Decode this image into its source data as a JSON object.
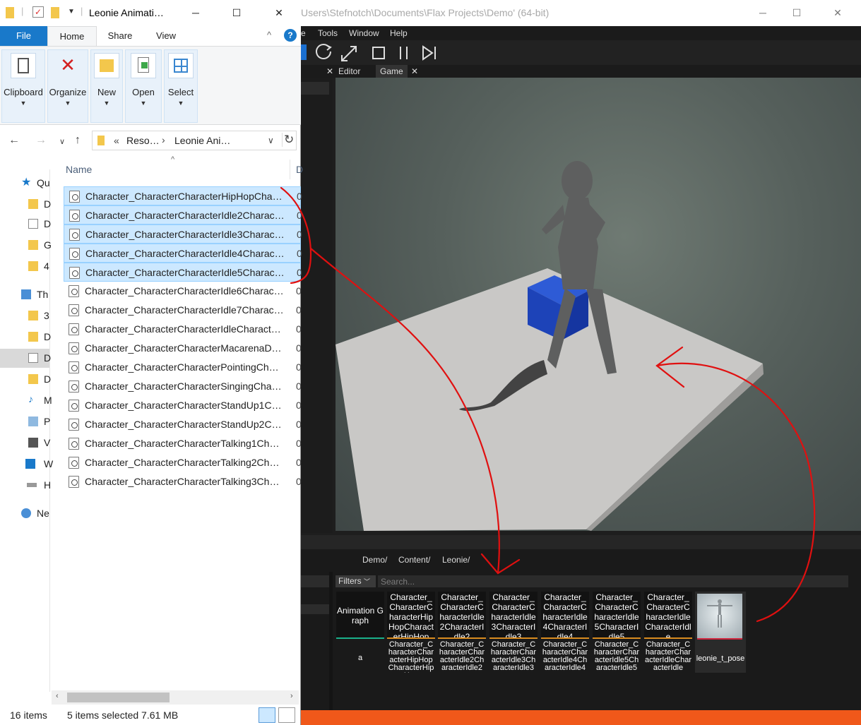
{
  "flax": {
    "title": "Users\\Stefnotch\\Documents\\Flax Projects\\Demo' (64-bit)",
    "menu": [
      "e",
      "Tools",
      "Window",
      "Help"
    ],
    "tabs": [
      {
        "label": "Editor"
      },
      {
        "label": "Game"
      }
    ],
    "breadcrumb": [
      "Demo/",
      "Content/",
      "Leonie/"
    ],
    "filters_label": "Filters",
    "search_placeholder": "Search...",
    "assets": [
      {
        "thumb": "Animation Graph",
        "name": "a"
      },
      {
        "thumb": "Character_CharacterCharacterHipHopCharacterHipHop",
        "name": "Character_CharacterCharacterHipHopCharacterHipHop"
      },
      {
        "thumb": "Character_CharacterCharacterIdle2CharacterIdle2",
        "name": "Character_CharacterCharacterIdle2CharacterIdle2"
      },
      {
        "thumb": "Character_CharacterCharacterIdle3CharacterIdle3",
        "name": "Character_CharacterCharacterIdle3CharacterIdle3"
      },
      {
        "thumb": "Character_CharacterCharacterIdle4CharacterIdle4",
        "name": "Character_CharacterCharacterIdle4CharacterIdle4"
      },
      {
        "thumb": "Character_CharacterCharacterIdle5CharacterIdle5",
        "name": "Character_CharacterCharacterIdle5CharacterIdle5"
      },
      {
        "thumb": "Character_CharacterCharacterIdleCharacterIdle",
        "name": "Character_CharacterCharacterIdleCharacterIdle"
      },
      {
        "thumb": "",
        "name": "leonie_t_pose"
      }
    ],
    "colors": {
      "accent_status": "#f0581a",
      "asset_underline": "#d88b1f"
    }
  },
  "explorer": {
    "title": "Leonie Animati…",
    "ribbon_tabs": [
      "File",
      "Home",
      "Share",
      "View"
    ],
    "ribbon_groups": [
      "Clipboard",
      "Organize",
      "New",
      "Open",
      "Select"
    ],
    "address": {
      "prefix": "«",
      "parts": [
        "Reso…",
        "Leonie Ani…"
      ]
    },
    "column_name": "Name",
    "column_next": "D",
    "sidebar": [
      "Qu",
      "D",
      "D",
      "G",
      "4",
      "Th",
      "3",
      "D",
      "D",
      "D",
      "M",
      "P",
      "V",
      "W",
      "H",
      "Ne"
    ],
    "files": [
      {
        "name": "Character_CharacterCharacterHipHopCha…",
        "selected": true
      },
      {
        "name": "Character_CharacterCharacterIdle2Charac…",
        "selected": true
      },
      {
        "name": "Character_CharacterCharacterIdle3Charac…",
        "selected": true
      },
      {
        "name": "Character_CharacterCharacterIdle4Charac…",
        "selected": true
      },
      {
        "name": "Character_CharacterCharacterIdle5Charac…",
        "selected": true
      },
      {
        "name": "Character_CharacterCharacterIdle6Charac…",
        "selected": false
      },
      {
        "name": "Character_CharacterCharacterIdle7Charac…",
        "selected": false
      },
      {
        "name": "Character_CharacterCharacterIdleCharact…",
        "selected": false
      },
      {
        "name": "Character_CharacterCharacterMacarenaD…",
        "selected": false
      },
      {
        "name": "Character_CharacterCharacterPointingCh…",
        "selected": false
      },
      {
        "name": "Character_CharacterCharacterSingingCha…",
        "selected": false
      },
      {
        "name": "Character_CharacterCharacterStandUp1C…",
        "selected": false
      },
      {
        "name": "Character_CharacterCharacterStandUp2C…",
        "selected": false
      },
      {
        "name": "Character_CharacterCharacterTalking1Ch…",
        "selected": false
      },
      {
        "name": "Character_CharacterCharacterTalking2Ch…",
        "selected": false
      },
      {
        "name": "Character_CharacterCharacterTalking3Ch…",
        "selected": false
      }
    ],
    "file_col_d": "0",
    "status_count": "16 items",
    "status_selected": "5 items selected  7.61 MB",
    "colors": {
      "file_tab": "#1979ca",
      "selection": "#cce8ff"
    }
  }
}
